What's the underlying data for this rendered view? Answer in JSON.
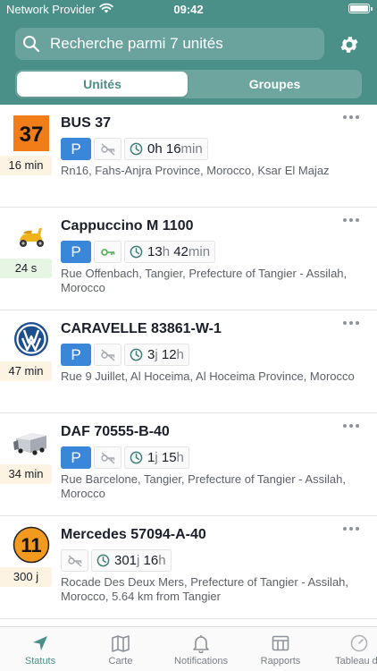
{
  "status_bar": {
    "carrier": "Network Provider",
    "time": "09:42"
  },
  "search": {
    "placeholder": "Recherche parmi 7 unités"
  },
  "segments": {
    "active": "Unités",
    "inactive": "Groupes"
  },
  "units": [
    {
      "name": "BUS 37",
      "icon": "road-sign-37-icon",
      "last_update": "16 min",
      "last_update_color": "#fdf3e3",
      "parking": "P",
      "ignition": "ignition-off-icon",
      "duration": [
        {
          "n": "0h",
          "u": ""
        },
        {
          "n": "16",
          "u": "min"
        }
      ],
      "address": "Rn16, Fahs-Anjra Province, Morocco, Ksar El Majaz"
    },
    {
      "name": "Cappuccino M 1100",
      "icon": "scooter-icon",
      "last_update": "24 s",
      "last_update_color": "#e7f5e5",
      "parking": "P",
      "ignition": "key-icon",
      "duration": [
        {
          "n": "13",
          "u": "h"
        },
        {
          "n": "42",
          "u": "min"
        }
      ],
      "address": "Rue Offenbach, Tangier, Prefecture of Tangier - Assilah, Morocco"
    },
    {
      "name": "CARAVELLE 83861-W-1",
      "icon": "volkswagen-logo-icon",
      "last_update": "47 min",
      "last_update_color": "#fdf3e3",
      "parking": "P",
      "ignition": "ignition-off-icon",
      "duration": [
        {
          "n": "3",
          "u": "j"
        },
        {
          "n": "12",
          "u": "h"
        }
      ],
      "address": "Rue 9 Juillet, Al Hoceima, Al Hoceima Province, Morocco"
    },
    {
      "name": "DAF 70555-B-40",
      "icon": "truck-icon",
      "last_update": "34 min",
      "last_update_color": "#fdf3e3",
      "parking": "P",
      "ignition": "ignition-off-icon",
      "duration": [
        {
          "n": "1",
          "u": "j"
        },
        {
          "n": "15",
          "u": "h"
        }
      ],
      "address": "Rue Barcelone, Tangier, Prefecture of Tangier - Assilah, Morocco"
    },
    {
      "name": "Mercedes 57094-A-40",
      "icon": "road-sign-11-icon",
      "last_update": "300 j",
      "last_update_color": "#fdf3e3",
      "parking": "",
      "ignition": "ignition-off-icon",
      "duration": [
        {
          "n": "301",
          "u": "j"
        },
        {
          "n": "16",
          "u": "h"
        }
      ],
      "address": "Rocade Des Deux Mers, Prefecture of Tangier - Assilah, Morocco, 5.64 km from Tangier"
    }
  ],
  "tabs": [
    {
      "label": "Statuts",
      "icon": "navigation-arrow-icon",
      "active": true
    },
    {
      "label": "Carte",
      "icon": "map-icon",
      "active": false
    },
    {
      "label": "Notifications",
      "icon": "bell-icon",
      "active": false
    },
    {
      "label": "Rapports",
      "icon": "table-icon",
      "active": false
    },
    {
      "label": "Tableau de",
      "icon": "dashboard-icon",
      "active": false
    }
  ],
  "colors": {
    "brand": "#4a8f88",
    "parking_chip": "#3a86d9",
    "key_green": "#4caf50"
  }
}
